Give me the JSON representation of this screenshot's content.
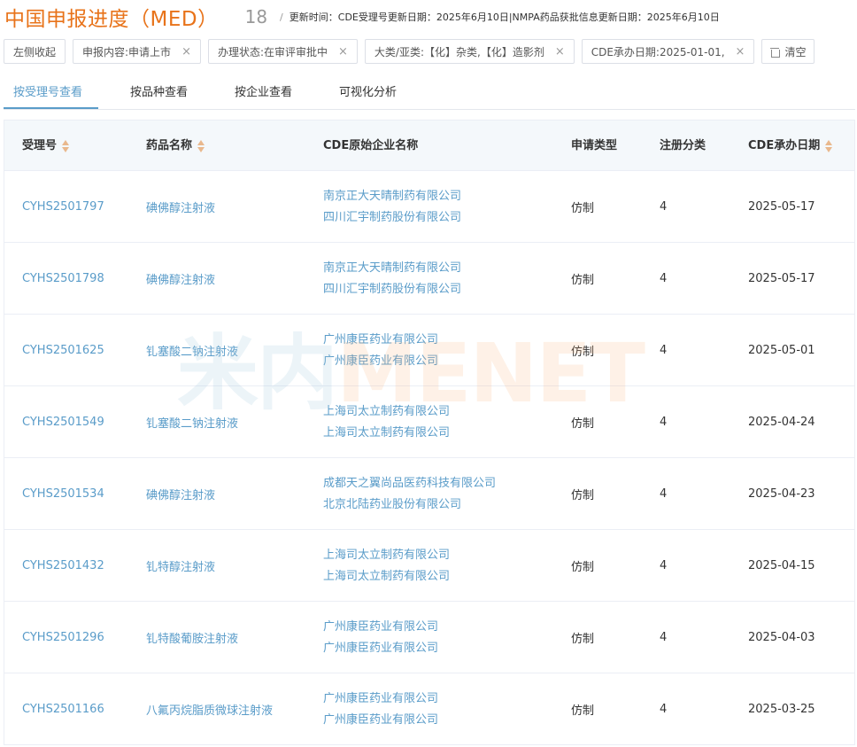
{
  "header": {
    "title": "中国申报进度（MED）",
    "count": "18",
    "separator": "/",
    "update_info": "更新时间：CDE受理号更新日期：2025年6月10日|NMPA药品获批信息更新日期：2025年6月10日"
  },
  "filters": {
    "collapse_label": "左侧收起",
    "chips": [
      {
        "label": "申报内容:申请上市"
      },
      {
        "label": "办理状态:在审评审批中"
      },
      {
        "label": "大类/亚类:【化】杂类,【化】造影剂"
      },
      {
        "label": "CDE承办日期:2025-01-01,"
      }
    ],
    "remove_icon": "×",
    "clear_label": "清空"
  },
  "tabs": [
    {
      "label": "按受理号查看",
      "active": true
    },
    {
      "label": "按品种查看",
      "active": false
    },
    {
      "label": "按企业查看",
      "active": false
    },
    {
      "label": "可视化分析",
      "active": false
    }
  ],
  "table": {
    "columns": [
      {
        "label": "受理号",
        "sortable": true
      },
      {
        "label": "药品名称",
        "sortable": true
      },
      {
        "label": "CDE原始企业名称",
        "sortable": false
      },
      {
        "label": "申请类型",
        "sortable": false
      },
      {
        "label": "注册分类",
        "sortable": false
      },
      {
        "label": "CDE承办日期",
        "sortable": true
      }
    ],
    "rows": [
      {
        "id": "CYHS2501797",
        "drug": "碘佛醇注射液",
        "companies": [
          "南京正大天晴制药有限公司",
          "四川汇宇制药股份有限公司"
        ],
        "type": "仿制",
        "class": "4",
        "date": "2025-05-17"
      },
      {
        "id": "CYHS2501798",
        "drug": "碘佛醇注射液",
        "companies": [
          "南京正大天晴制药有限公司",
          "四川汇宇制药股份有限公司"
        ],
        "type": "仿制",
        "class": "4",
        "date": "2025-05-17"
      },
      {
        "id": "CYHS2501625",
        "drug": "钆塞酸二钠注射液",
        "companies": [
          "广州康臣药业有限公司",
          "广州康臣药业有限公司"
        ],
        "type": "仿制",
        "class": "4",
        "date": "2025-05-01"
      },
      {
        "id": "CYHS2501549",
        "drug": "钆塞酸二钠注射液",
        "companies": [
          "上海司太立制药有限公司",
          "上海司太立制药有限公司"
        ],
        "type": "仿制",
        "class": "4",
        "date": "2025-04-24"
      },
      {
        "id": "CYHS2501534",
        "drug": "碘佛醇注射液",
        "companies": [
          "成都天之翼尚品医药科技有限公司",
          "北京北陆药业股份有限公司"
        ],
        "type": "仿制",
        "class": "4",
        "date": "2025-04-23"
      },
      {
        "id": "CYHS2501432",
        "drug": "钆特醇注射液",
        "companies": [
          "上海司太立制药有限公司",
          "上海司太立制药有限公司"
        ],
        "type": "仿制",
        "class": "4",
        "date": "2025-04-15"
      },
      {
        "id": "CYHS2501296",
        "drug": "钆特酸葡胺注射液",
        "companies": [
          "广州康臣药业有限公司",
          "广州康臣药业有限公司"
        ],
        "type": "仿制",
        "class": "4",
        "date": "2025-04-03"
      },
      {
        "id": "CYHS2501166",
        "drug": "八氟丙烷脂质微球注射液",
        "companies": [
          "广州康臣药业有限公司",
          "广州康臣药业有限公司"
        ],
        "type": "仿制",
        "class": "4",
        "date": "2025-03-25"
      }
    ]
  },
  "watermark": {
    "cn": "米内",
    "en": "MENET"
  },
  "colors": {
    "accent": "#e8731a",
    "link": "#5a9cc9",
    "header_bg": "#f4f8fb"
  }
}
